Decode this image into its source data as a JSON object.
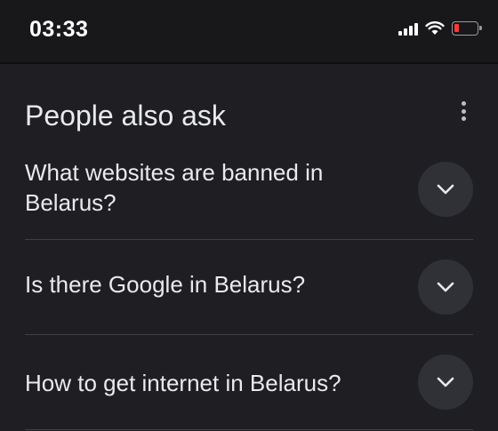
{
  "status_bar": {
    "time": "03:33",
    "icons": [
      "signal-icon",
      "wifi-icon",
      "battery-icon"
    ],
    "battery_color": "#ff3b30"
  },
  "section": {
    "title": "People also ask",
    "menu_icon": "more-vert-icon"
  },
  "questions": [
    {
      "text": "What websites are banned in Belarus?",
      "icon": "chevron-down-icon"
    },
    {
      "text": "Is there Google in Belarus?",
      "icon": "chevron-down-icon"
    },
    {
      "text": "How to get internet in Belarus?",
      "icon": "chevron-down-icon"
    }
  ]
}
